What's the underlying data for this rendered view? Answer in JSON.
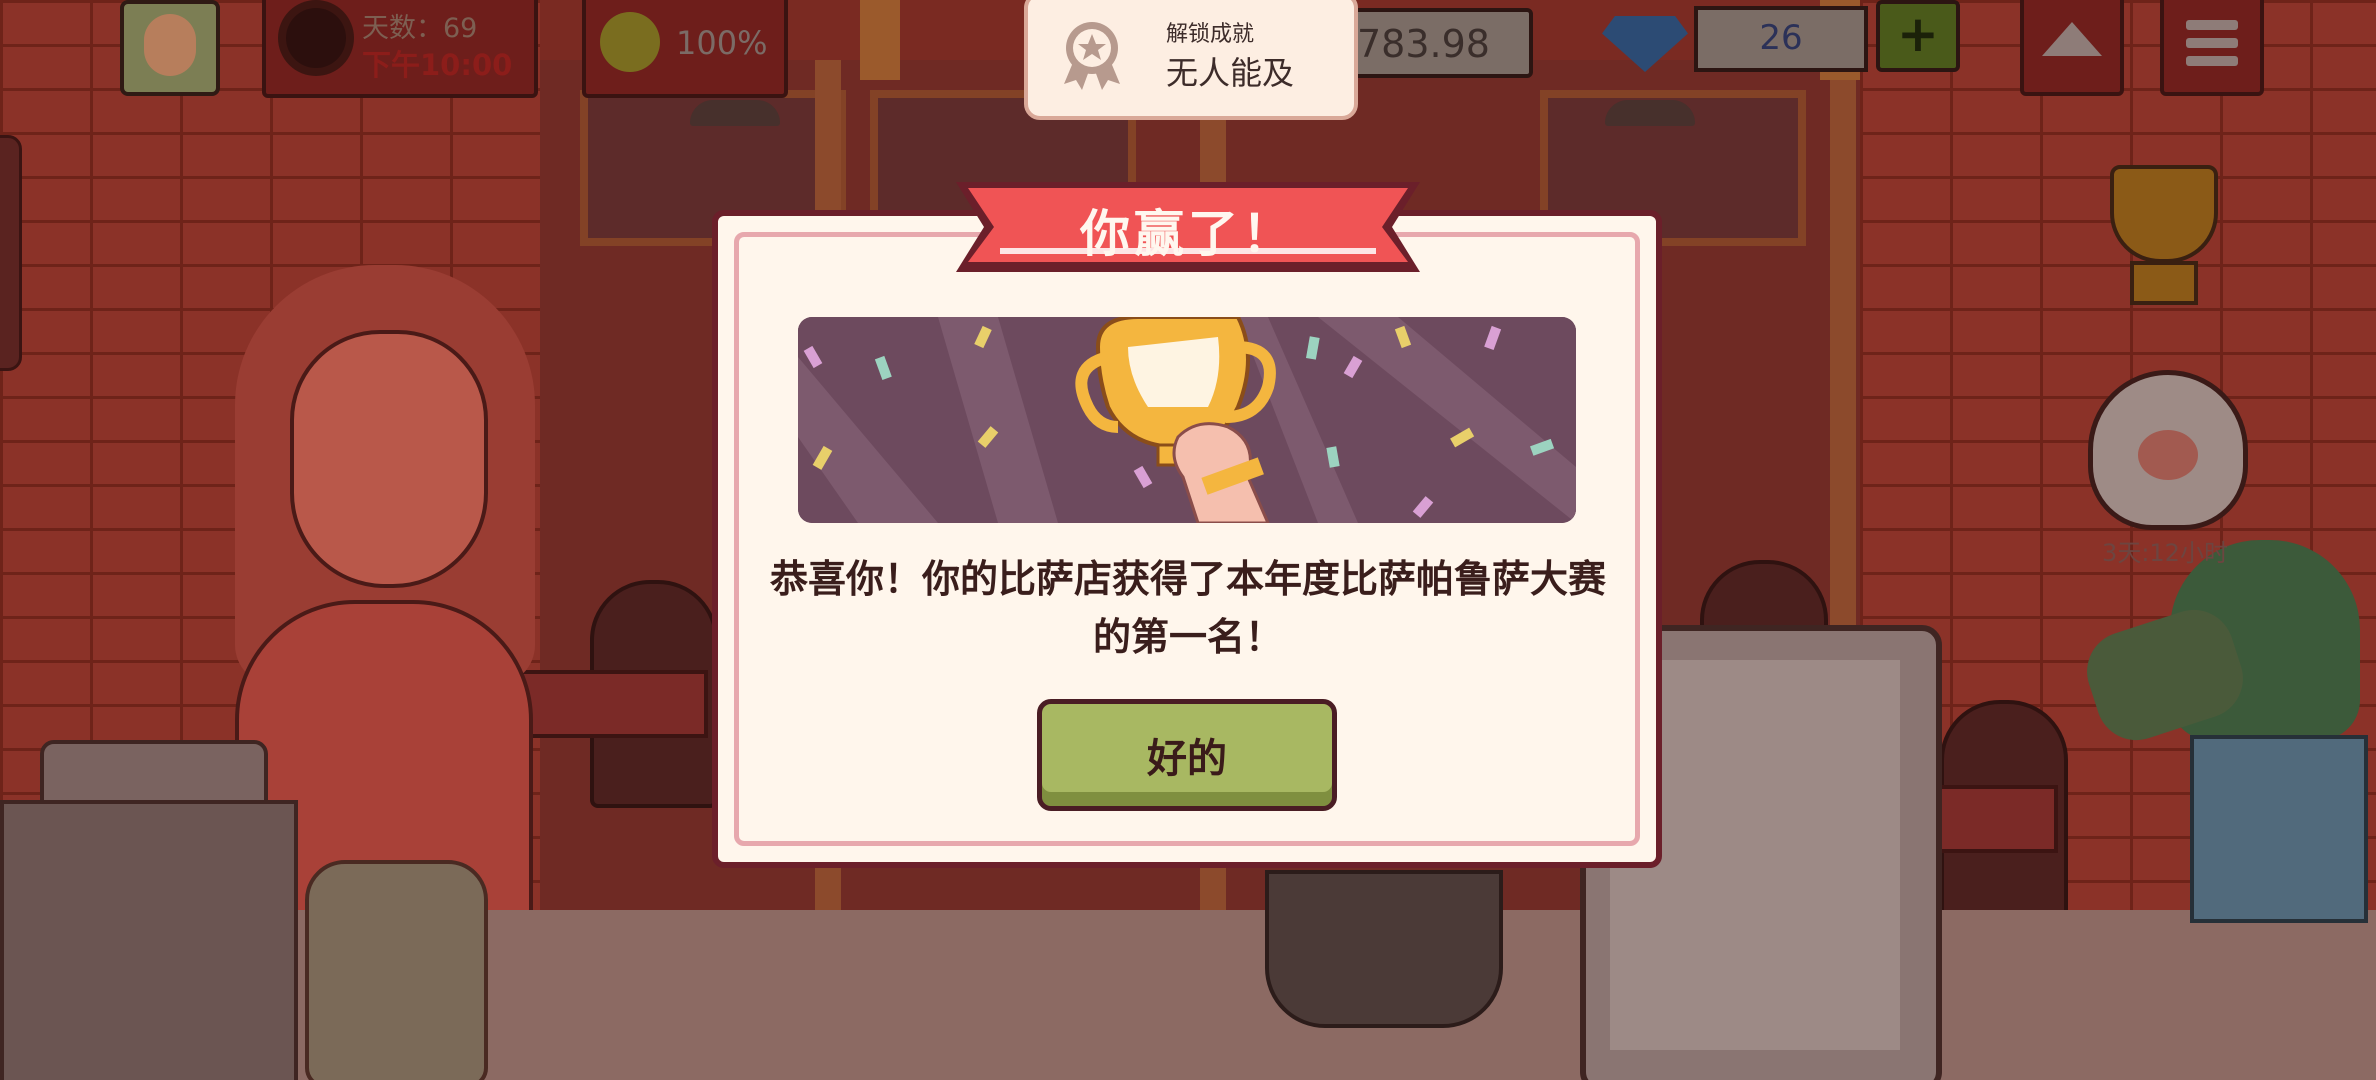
{
  "hud": {
    "day_label": "天数：69",
    "time_label": "下午10:00",
    "mood_percent": "100%",
    "money": "783.98",
    "gems": "26",
    "add_button_label": "+"
  },
  "side": {
    "paw_timer": "3天:12小时"
  },
  "achievement_toast": {
    "kicker": "解锁成就",
    "title": "无人能及"
  },
  "dialog": {
    "title": "你赢了！",
    "message": "恭喜你！你的比萨店获得了本年度比萨帕鲁萨大赛的第一名！",
    "ok_label": "好的"
  },
  "colors": {
    "banner_red": "#f05455",
    "modal_bg": "#fff6ec",
    "modal_border": "#6b1f2a",
    "ok_green": "#a8b862"
  }
}
